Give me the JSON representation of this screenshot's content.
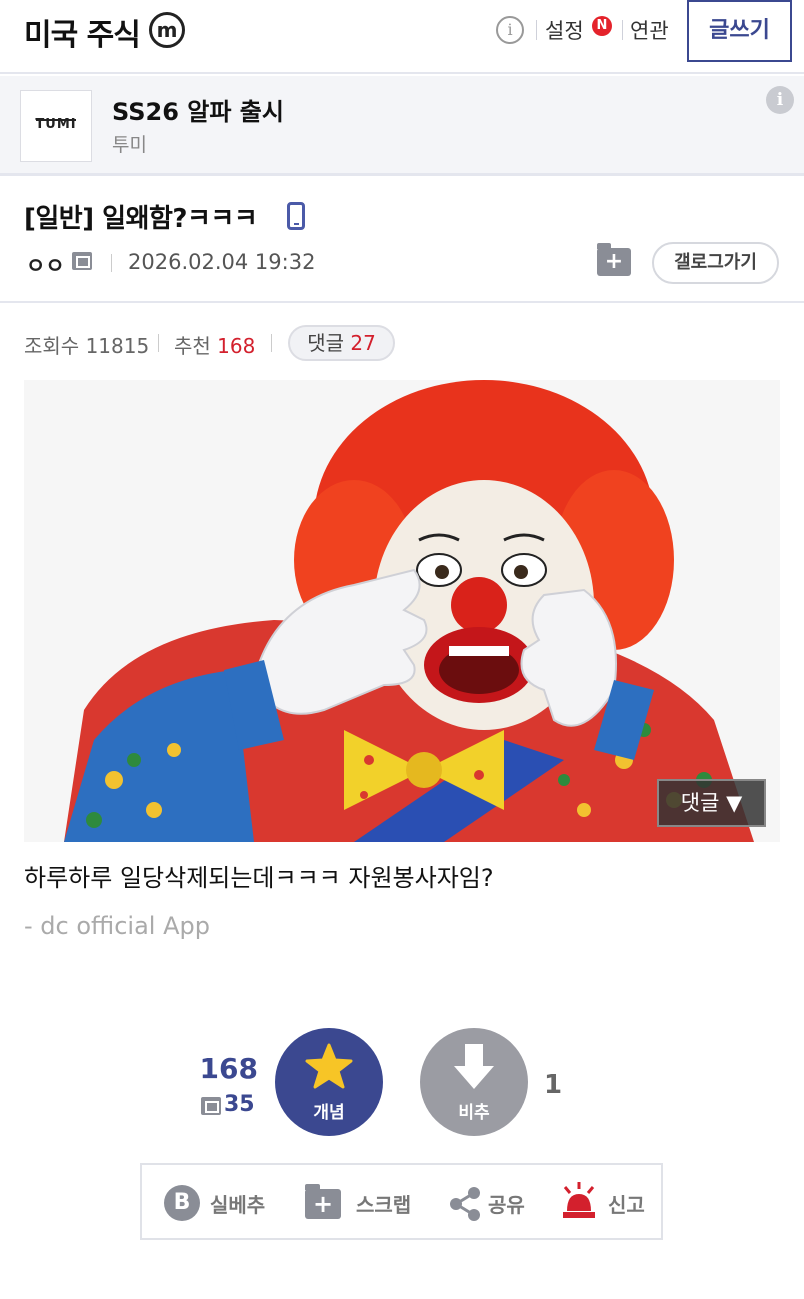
{
  "header": {
    "gallery_title": "미국 주식",
    "minor_badge": "m",
    "info_glyph": "i",
    "settings_label": "설정",
    "new_badge": "N",
    "related_label": "연관",
    "write_label": "글쓰기"
  },
  "ad": {
    "logo_text": "TUMI",
    "title": "SS26 알파 출시",
    "advertiser": "투미",
    "info_glyph": "i"
  },
  "post": {
    "title": "[일반] 일왜함?ㅋㅋㅋ",
    "author": "ㅇㅇ",
    "date": "2026.02.04 19:32",
    "gallery_button": "갤로그가기",
    "views_label": "조회수",
    "views": "11815",
    "recommend_label": "추천",
    "recommend": "168",
    "comments_label": "댓글",
    "comments": "27",
    "comment_jump_label": "댓글 ▼",
    "body": "하루하루 일당삭제되는데ㅋㅋㅋ 자원봉사자임?",
    "footer": "- dc official App"
  },
  "votes": {
    "up_count": "168",
    "fixed_count": "35",
    "up_label": "개념",
    "down_label": "비추",
    "down_count": "1"
  },
  "actions": {
    "best_icon": "B",
    "best_label": "실베추",
    "scrap_label": "스크랩",
    "share_label": "공유",
    "report_label": "신고"
  },
  "colors": {
    "accent": "#3b4890",
    "red": "#d3202d",
    "gray": "#8a8d96"
  }
}
